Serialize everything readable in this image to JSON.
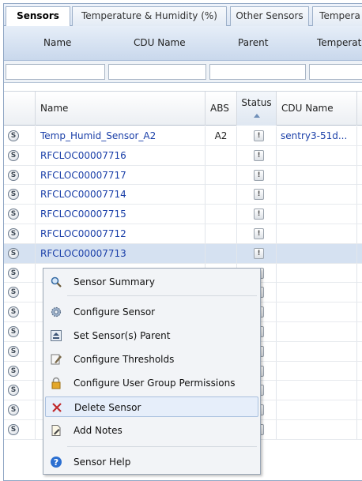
{
  "tabs": [
    "Sensors",
    "Temperature & Humidity (%)",
    "Other Sensors",
    "Tempera"
  ],
  "header_strip": [
    "Name",
    "CDU Name",
    "Parent",
    "Temperatu"
  ],
  "columns": {
    "name": "Name",
    "abs": "ABS",
    "status": "Status",
    "cdu": "CDU Name"
  },
  "rows": [
    {
      "name": "Temp_Humid_Sensor_A2",
      "abs": "A2",
      "cdu": "sentry3-51d..."
    },
    {
      "name": "RFCLOC00007716",
      "abs": "",
      "cdu": ""
    },
    {
      "name": "RFCLOC00007717",
      "abs": "",
      "cdu": ""
    },
    {
      "name": "RFCLOC00007714",
      "abs": "",
      "cdu": ""
    },
    {
      "name": "RFCLOC00007715",
      "abs": "",
      "cdu": ""
    },
    {
      "name": "RFCLOC00007712",
      "abs": "",
      "cdu": ""
    },
    {
      "name": "RFCLOC00007713",
      "abs": "",
      "cdu": ""
    },
    {
      "name": "",
      "abs": "",
      "cdu": ""
    },
    {
      "name": "",
      "abs": "",
      "cdu": ""
    },
    {
      "name": "",
      "abs": "",
      "cdu": ""
    },
    {
      "name": "",
      "abs": "",
      "cdu": ""
    },
    {
      "name": "",
      "abs": "",
      "cdu": ""
    },
    {
      "name": "",
      "abs": "",
      "cdu": ""
    },
    {
      "name": "",
      "abs": "",
      "cdu": ""
    },
    {
      "name": "",
      "abs": "",
      "cdu": ""
    },
    {
      "name": "",
      "abs": "",
      "cdu": ""
    }
  ],
  "context_menu": {
    "items": [
      {
        "label": "Sensor Summary",
        "icon": "magnifier-icon"
      },
      {
        "label": "Configure Sensor",
        "icon": "gear-icon"
      },
      {
        "label": "Set Sensor(s) Parent",
        "icon": "parent-icon"
      },
      {
        "label": "Configure Thresholds",
        "icon": "pencil-icon"
      },
      {
        "label": "Configure User Group Permissions",
        "icon": "lock-icon"
      },
      {
        "label": "Delete Sensor",
        "icon": "delete-icon"
      },
      {
        "label": "Add Notes",
        "icon": "notes-icon"
      },
      {
        "label": "Sensor Help",
        "icon": "help-icon"
      }
    ]
  },
  "colors": {
    "link_blue": "#1a3fa8",
    "selected_row": "#d5e1f1",
    "delete_red": "#c0282a",
    "help_blue": "#2b6fd1"
  }
}
